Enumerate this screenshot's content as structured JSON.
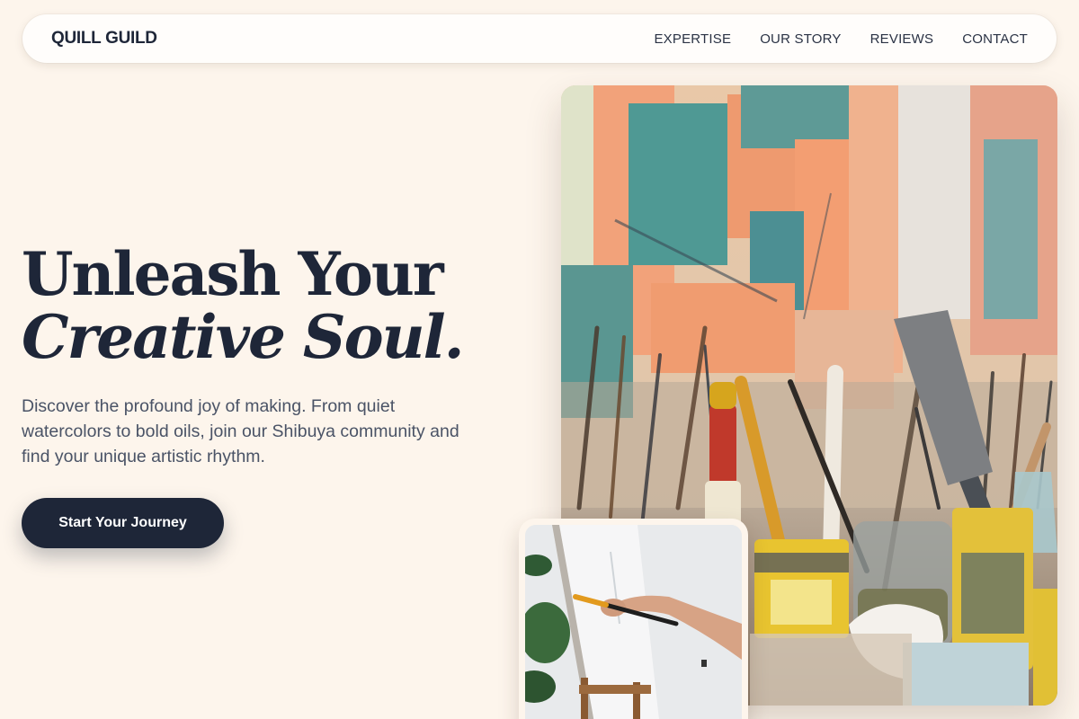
{
  "nav": {
    "brand": "QUILL GUILD",
    "links": [
      {
        "label": "EXPERTISE"
      },
      {
        "label": "OUR STORY"
      },
      {
        "label": "REVIEWS"
      },
      {
        "label": "CONTACT"
      }
    ]
  },
  "hero": {
    "title_line1": "Unleash Your",
    "title_line2": "Creative Soul.",
    "description": "Discover the profound joy of making. From quiet watercolors to bold oils, join our Shibuya community and find your unique artistic rhythm.",
    "cta_label": "Start Your Journey"
  },
  "colors": {
    "background": "#fdf5ec",
    "primary": "#1e2638",
    "text_muted": "#4a5366"
  },
  "images": {
    "main": "art-studio-brushes-photo",
    "secondary": "painting-on-easel-photo"
  }
}
